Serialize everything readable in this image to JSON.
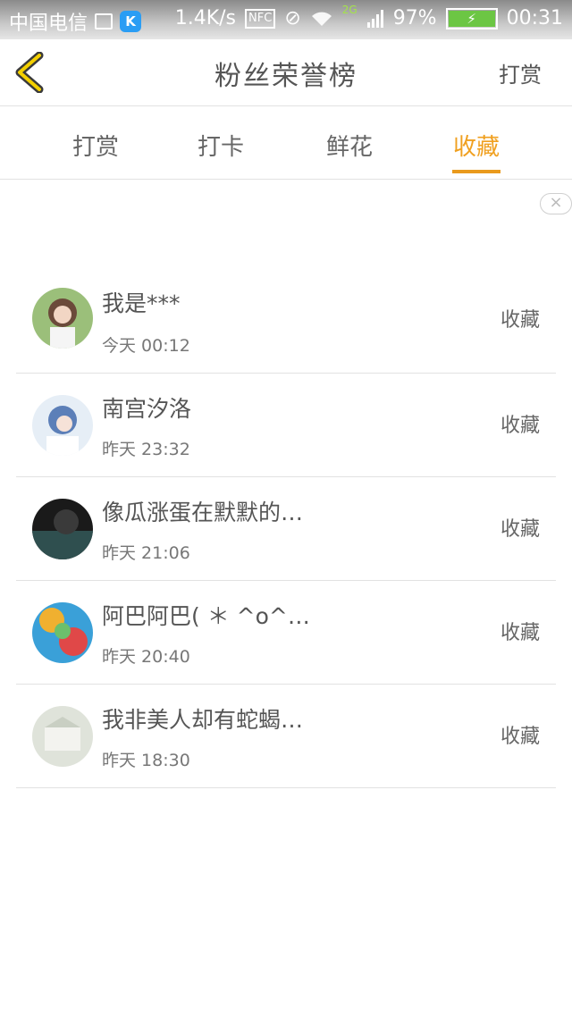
{
  "status_bar": {
    "carrier": "中国电信",
    "speed": "1.4K/s",
    "nfc": "NFC",
    "network": "2G",
    "battery": "97%",
    "battery_level": 0.97,
    "time": "00:31"
  },
  "header": {
    "title": "粉丝荣誉榜",
    "action_label": "打赏"
  },
  "tabs": [
    {
      "label": "打赏"
    },
    {
      "label": "打卡"
    },
    {
      "label": "鲜花"
    },
    {
      "label": "收藏"
    }
  ],
  "active_tab": "收藏",
  "colors": {
    "accent": "#e99a1d",
    "divider": "#e2e2e2",
    "text": "#555555"
  },
  "close_label": "×",
  "list": [
    {
      "name": "我是***",
      "time": "今天 00:12",
      "action": "收藏",
      "avatar": "anime-girl-avatar"
    },
    {
      "name": "南宫汐洛",
      "time": "昨天 23:32",
      "action": "收藏",
      "avatar": "anime-girl-blue-hair-avatar"
    },
    {
      "name": "像瓜涨蛋在默默的…",
      "time": "昨天 21:06",
      "action": "收藏",
      "avatar": "dark-photo-avatar"
    },
    {
      "name": "阿巴阿巴( ＊ ^o^…",
      "time": "昨天 20:40",
      "action": "收藏",
      "avatar": "colorful-avatar"
    },
    {
      "name": "我非美人却有蛇蝎…",
      "time": "昨天 18:30",
      "action": "收藏",
      "avatar": "pale-photo-avatar"
    }
  ]
}
